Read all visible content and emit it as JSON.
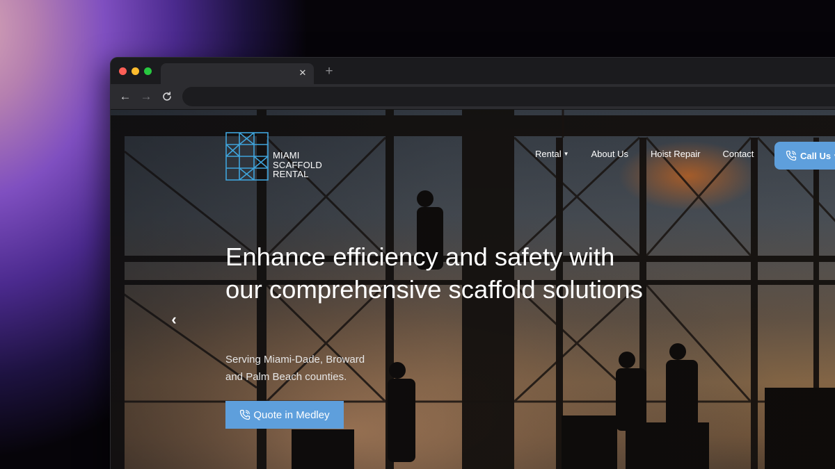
{
  "browser": {
    "tab_close_icon": "close-icon",
    "new_tab_icon": "plus-icon",
    "back_icon": "arrow-left-icon",
    "forward_icon": "arrow-right-icon",
    "reload_icon": "reload-icon",
    "address_value": ""
  },
  "site": {
    "logo": {
      "line1": "MIAMI",
      "line2": "SCAFFOLD",
      "line3": "RENTAL"
    },
    "nav": {
      "items": [
        {
          "label": "Rental",
          "has_dropdown": true
        },
        {
          "label": "About Us"
        },
        {
          "label": "Hoist Repair"
        },
        {
          "label": "Contact"
        }
      ],
      "call_button": {
        "label": "Call Us",
        "icon": "phone-icon",
        "has_dropdown": true
      }
    },
    "hero": {
      "headline": "Enhance efficiency and safety with our comprehensive scaffold solutions",
      "subtext_line1": "Serving Miami-Dade, Broward",
      "subtext_line2": "and Palm Beach counties.",
      "quote_button": {
        "label": "Quote in Medley",
        "icon": "phone-icon"
      },
      "prev_arrow_icon": "chevron-left-icon"
    }
  },
  "colors": {
    "accent": "#5e9fdc",
    "logo_mark": "#3fa4dc",
    "backdrop_gradient": [
      "#d7a6b4",
      "#7f4fc0",
      "#060409"
    ]
  }
}
